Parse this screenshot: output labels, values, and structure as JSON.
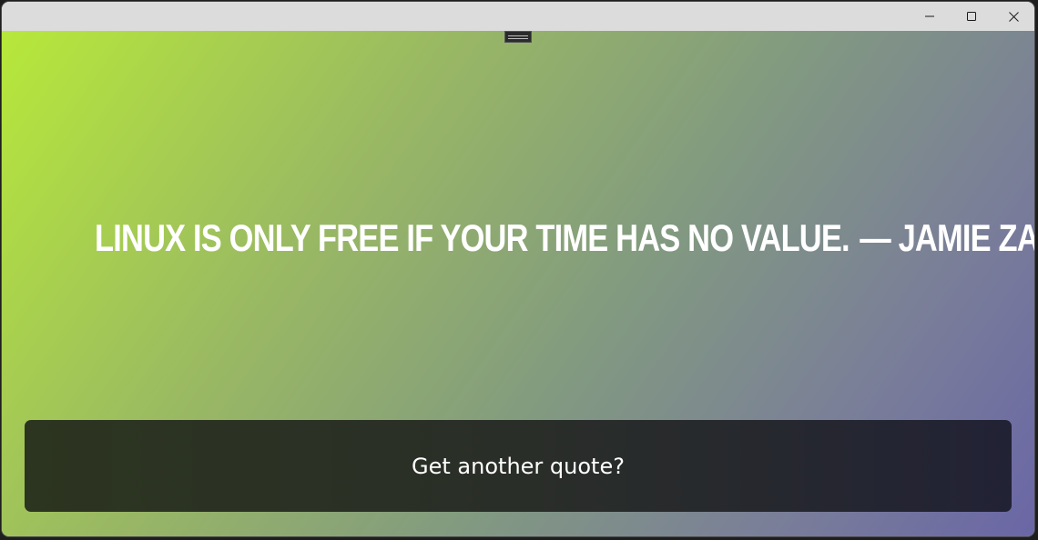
{
  "window": {
    "controls": {
      "minimize_icon": "minimize-icon",
      "maximize_icon": "maximize-icon",
      "close_icon": "close-icon"
    }
  },
  "quote": {
    "text": "Linux is only free if your time has no value.",
    "author": "— Jamie Zawinski"
  },
  "button": {
    "label": "Get another quote?"
  },
  "colors": {
    "gradient_start": "#b7e83a",
    "gradient_end": "#6a66a6",
    "button_bg": "#2a2e28",
    "text": "#ffffff"
  }
}
